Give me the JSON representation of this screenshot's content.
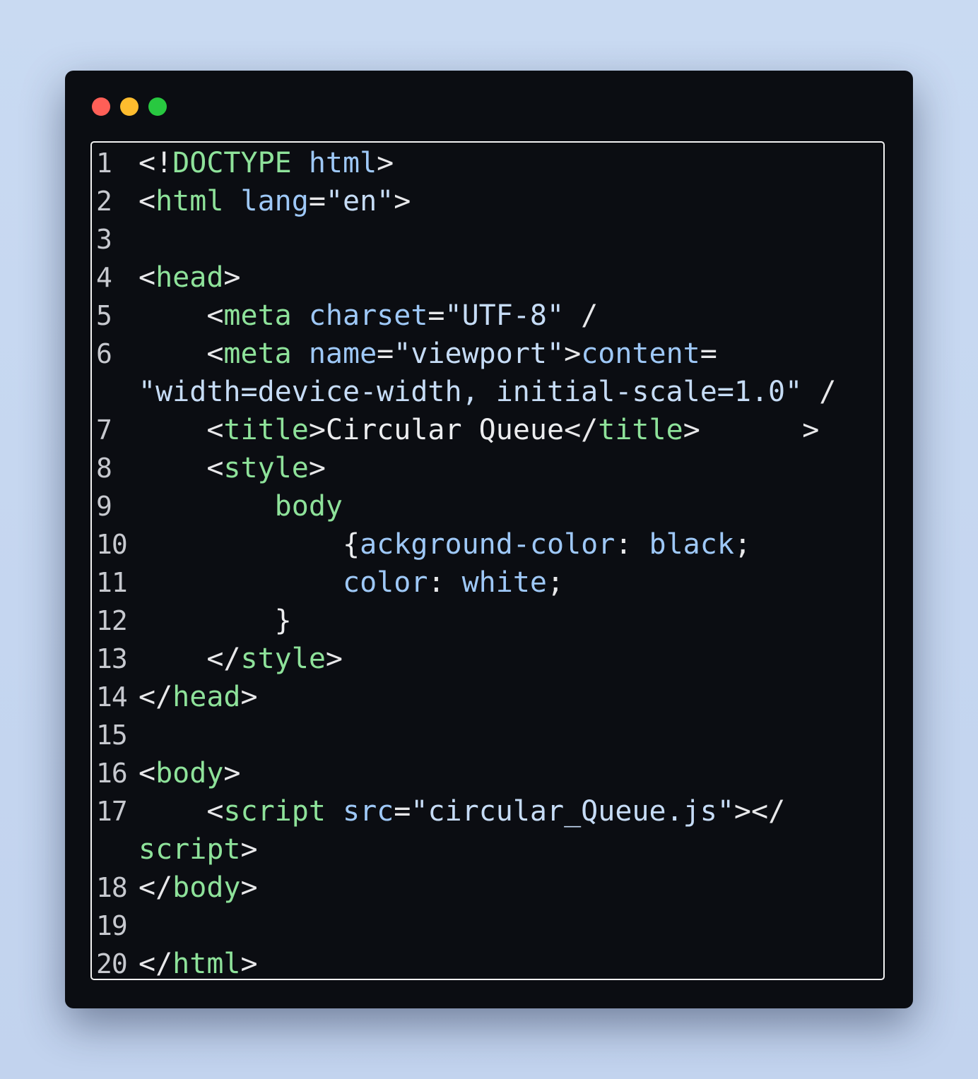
{
  "window": {
    "controls": {
      "close_color": "#ff5f57",
      "minimize_color": "#febc2e",
      "maximize_color": "#28c840"
    }
  },
  "editor": {
    "lines": [
      {
        "number": "1",
        "tokens": [
          {
            "t": "<!",
            "k": "punc"
          },
          {
            "t": "DOCTYPE",
            "k": "tag"
          },
          {
            "t": " ",
            "k": "punc"
          },
          {
            "t": "html",
            "k": "attr"
          },
          {
            "t": ">",
            "k": "punc"
          }
        ]
      },
      {
        "number": "2",
        "tokens": [
          {
            "t": "<",
            "k": "punc"
          },
          {
            "t": "html",
            "k": "tag"
          },
          {
            "t": " ",
            "k": "punc"
          },
          {
            "t": "lang",
            "k": "attr"
          },
          {
            "t": "=",
            "k": "punc"
          },
          {
            "t": "\"en\"",
            "k": "str"
          },
          {
            "t": ">",
            "k": "punc"
          }
        ]
      },
      {
        "number": "3",
        "tokens": []
      },
      {
        "number": "4",
        "tokens": [
          {
            "t": "<",
            "k": "punc"
          },
          {
            "t": "head",
            "k": "tag"
          },
          {
            "t": ">",
            "k": "punc"
          }
        ]
      },
      {
        "number": "5",
        "tokens": [
          {
            "t": "    <",
            "k": "punc"
          },
          {
            "t": "meta",
            "k": "tag"
          },
          {
            "t": " ",
            "k": "punc"
          },
          {
            "t": "charset",
            "k": "attr"
          },
          {
            "t": "=",
            "k": "punc"
          },
          {
            "t": "\"UTF-8\"",
            "k": "str"
          },
          {
            "t": " /",
            "k": "punc"
          }
        ]
      },
      {
        "number": "6",
        "tokens": [
          {
            "t": "    <",
            "k": "punc"
          },
          {
            "t": "meta",
            "k": "tag"
          },
          {
            "t": " ",
            "k": "punc"
          },
          {
            "t": "name",
            "k": "attr"
          },
          {
            "t": "=",
            "k": "punc"
          },
          {
            "t": "\"viewport\"",
            "k": "str"
          },
          {
            "t": ">",
            "k": "punc"
          },
          {
            "t": "content",
            "k": "attr"
          },
          {
            "t": "=",
            "k": "punc"
          }
        ]
      },
      {
        "number": "",
        "tokens": [
          {
            "t": "\"width=device-width, initial-scale=1.0\"",
            "k": "str"
          },
          {
            "t": " /",
            "k": "punc"
          }
        ]
      },
      {
        "number": "7",
        "tokens": [
          {
            "t": "    <",
            "k": "punc"
          },
          {
            "t": "title",
            "k": "tag"
          },
          {
            "t": ">",
            "k": "punc"
          },
          {
            "t": "Circular Queue",
            "k": "text"
          },
          {
            "t": "</",
            "k": "punc"
          },
          {
            "t": "title",
            "k": "tag"
          },
          {
            "t": ">      >",
            "k": "punc"
          }
        ]
      },
      {
        "number": "8",
        "tokens": [
          {
            "t": "    <",
            "k": "punc"
          },
          {
            "t": "style",
            "k": "tag"
          },
          {
            "t": ">",
            "k": "punc"
          }
        ]
      },
      {
        "number": "9",
        "tokens": [
          {
            "t": "        ",
            "k": "punc"
          },
          {
            "t": "body",
            "k": "tag"
          }
        ]
      },
      {
        "number": "10",
        "tokens": [
          {
            "t": "            ",
            "k": "punc"
          },
          {
            "t": "{",
            "k": "text"
          },
          {
            "t": "ackground-color",
            "k": "prop"
          },
          {
            "t": ": ",
            "k": "punc"
          },
          {
            "t": "black",
            "k": "val"
          },
          {
            "t": ";",
            "k": "punc"
          }
        ]
      },
      {
        "number": "11",
        "tokens": [
          {
            "t": "            ",
            "k": "punc"
          },
          {
            "t": "color",
            "k": "prop"
          },
          {
            "t": ": ",
            "k": "punc"
          },
          {
            "t": "white",
            "k": "val"
          },
          {
            "t": ";",
            "k": "punc"
          }
        ]
      },
      {
        "number": "12",
        "tokens": [
          {
            "t": "        }",
            "k": "text"
          }
        ]
      },
      {
        "number": "13",
        "tokens": [
          {
            "t": "    </",
            "k": "punc"
          },
          {
            "t": "style",
            "k": "tag"
          },
          {
            "t": ">",
            "k": "punc"
          }
        ]
      },
      {
        "number": "14",
        "tokens": [
          {
            "t": "</",
            "k": "punc"
          },
          {
            "t": "head",
            "k": "tag"
          },
          {
            "t": ">",
            "k": "punc"
          }
        ]
      },
      {
        "number": "15",
        "tokens": []
      },
      {
        "number": "16",
        "tokens": [
          {
            "t": "<",
            "k": "punc"
          },
          {
            "t": "body",
            "k": "tag"
          },
          {
            "t": ">",
            "k": "punc"
          }
        ]
      },
      {
        "number": "17",
        "tokens": [
          {
            "t": "    <",
            "k": "punc"
          },
          {
            "t": "script",
            "k": "tag"
          },
          {
            "t": " ",
            "k": "punc"
          },
          {
            "t": "src",
            "k": "attr"
          },
          {
            "t": "=",
            "k": "punc"
          },
          {
            "t": "\"circular_Queue.js\"",
            "k": "str"
          },
          {
            "t": "></",
            "k": "punc"
          }
        ]
      },
      {
        "number": "",
        "tokens": [
          {
            "t": "script",
            "k": "tag"
          },
          {
            "t": ">",
            "k": "punc"
          }
        ]
      },
      {
        "number": "18",
        "tokens": [
          {
            "t": "</",
            "k": "punc"
          },
          {
            "t": "body",
            "k": "tag"
          },
          {
            "t": ">",
            "k": "punc"
          }
        ]
      },
      {
        "number": "19",
        "tokens": []
      },
      {
        "number": "20",
        "tokens": [
          {
            "t": "</",
            "k": "punc"
          },
          {
            "t": "html",
            "k": "tag"
          },
          {
            "t": ">",
            "k": "punc"
          }
        ]
      }
    ]
  }
}
